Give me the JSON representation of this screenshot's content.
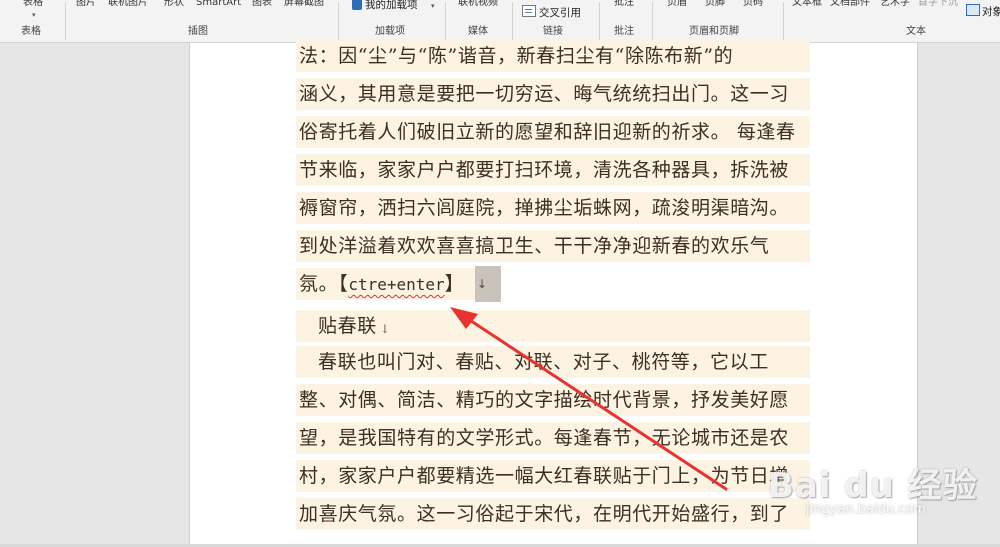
{
  "ribbon": {
    "groups": {
      "table": "表格",
      "illustrations": "插图",
      "addins": "加载项",
      "media": "媒体",
      "links": "链接",
      "comments": "批注",
      "header_footer": "页眉和页脚",
      "text": "文本"
    },
    "buttons": {
      "table": "表格",
      "picture": "图片",
      "online_picture": "联机图片",
      "shapes": "形状",
      "smartart": "SmartArt",
      "chart": "图表",
      "screenshot": "屏幕截图",
      "my_addins": "我的加载项",
      "online_video": "联机视频",
      "cross_reference": "交叉引用",
      "comment": "批注",
      "header": "页眉",
      "footer": "页脚",
      "page_number": "页码",
      "text_box": "文本框",
      "doc_parts": "文档部件",
      "wordart": "艺术字",
      "drop_cap": "首字下沉",
      "object": "对象"
    }
  },
  "document": {
    "lines": [
      "法：因“尘”与“陈”谐音，新春扫尘有“除陈布新”的",
      "涵义，其用意是要把一切穷运、晦气统统扫出门。这一习",
      "俗寄托着人们破旧立新的愿望和辞旧迎新的祈求。 每逢春",
      "节来临，家家户户都要打扫环境，清洗各种器具，拆洗被",
      "褥窗帘，洒扫六闾庭院，掸拂尘垢蛛网，疏浚明渠暗沟。",
      "到处洋溢着欢欢喜喜搞卫生、干干净净迎新春的欢乐气"
    ],
    "line7_prefix": "氛。【",
    "line7_code": "ctre+enter",
    "line7_suffix": "】",
    "paragraph_mark": "↓",
    "heading": "贴春联",
    "lines2": [
      "春联也叫门对、春贴、对联、对子、桃符等，它以工",
      "整、对偶、简洁、精巧的文字描绘时代背景，抒发美好愿",
      "望，是我国特有的文学形式。每逢春节，无论城市还是农",
      "村，家家户户都要精选一幅大红春联贴于门上，为节日增",
      "加喜庆气氛。这一习俗起于宋代，在明代开始盛行，到了"
    ]
  },
  "watermark": {
    "logo": "Bai du 经验",
    "url": "jingyan.baidu.com"
  },
  "colors": {
    "arrow": "#e8332e",
    "highlight": "#fdf3e3",
    "selection": "#c9c3bc"
  }
}
